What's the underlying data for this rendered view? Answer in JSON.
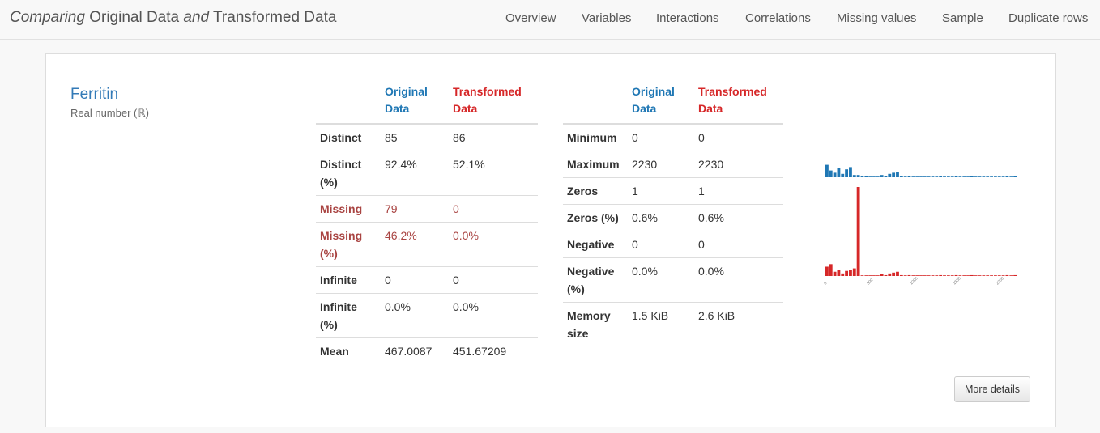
{
  "navbar": {
    "brand_part1": "Comparing",
    "brand_part2": " Original Data ",
    "brand_part3": "and",
    "brand_part4": " Transformed Data",
    "items": [
      "Overview",
      "Variables",
      "Interactions",
      "Correlations",
      "Missing values",
      "Sample",
      "Duplicate rows"
    ]
  },
  "variable": {
    "name": "Ferritin",
    "type": "Real number (ℝ)"
  },
  "table_left": {
    "header_orig": "Original Data",
    "header_trans": "Transformed Data",
    "rows": [
      {
        "label": "Distinct",
        "orig": "85",
        "trans": "86"
      },
      {
        "label": "Distinct (%)",
        "orig": "92.4%",
        "trans": "52.1%"
      },
      {
        "label": "Missing",
        "orig": "79",
        "trans": "0"
      },
      {
        "label": "Missing (%)",
        "orig": "46.2%",
        "trans": "0.0%"
      },
      {
        "label": "Infinite",
        "orig": "0",
        "trans": "0"
      },
      {
        "label": "Infinite (%)",
        "orig": "0.0%",
        "trans": "0.0%"
      },
      {
        "label": "Mean",
        "orig": "467.0087",
        "trans": "451.67209"
      }
    ]
  },
  "table_right": {
    "header_orig": "Original Data",
    "header_trans": "Transformed Data",
    "rows": [
      {
        "label": "Minimum",
        "orig": "0",
        "trans": "0"
      },
      {
        "label": "Maximum",
        "orig": "2230",
        "trans": "2230"
      },
      {
        "label": "Zeros",
        "orig": "1",
        "trans": "1"
      },
      {
        "label": "Zeros (%)",
        "orig": "0.6%",
        "trans": "0.6%"
      },
      {
        "label": "Negative",
        "orig": "0",
        "trans": "0"
      },
      {
        "label": "Negative (%)",
        "orig": "0.0%",
        "trans": "0.0%"
      },
      {
        "label": "Memory size",
        "orig": "1.5 KiB",
        "trans": "2.6 KiB"
      }
    ]
  },
  "more_details_label": "More details",
  "colors": {
    "original": "#1f77b4",
    "transformed": "#d62728",
    "link": "#337ab7",
    "missing": "#a94442"
  },
  "histogram": {
    "x_ticks": [
      "0",
      "500",
      "1000",
      "1500",
      "2000"
    ],
    "original_counts": [
      11,
      6,
      4,
      8,
      3,
      7,
      9,
      2,
      2,
      1,
      1,
      0,
      0,
      0,
      2,
      1,
      3,
      4,
      5,
      1,
      0,
      1,
      0,
      0,
      0,
      0,
      0,
      0,
      0,
      1,
      0,
      0,
      0,
      1,
      0,
      0,
      0,
      1,
      0,
      0,
      0,
      0,
      0,
      0,
      0,
      0,
      1,
      0,
      1
    ],
    "transformed_counts": [
      11,
      14,
      5,
      7,
      3,
      6,
      7,
      9,
      105,
      0,
      0,
      0,
      0,
      0,
      2,
      1,
      3,
      4,
      5,
      1,
      0,
      1,
      0,
      0,
      0,
      0,
      0,
      0,
      0,
      1,
      0,
      0,
      0,
      1,
      0,
      0,
      0,
      1,
      0,
      0,
      0,
      0,
      0,
      0,
      0,
      0,
      1,
      0,
      1
    ]
  }
}
